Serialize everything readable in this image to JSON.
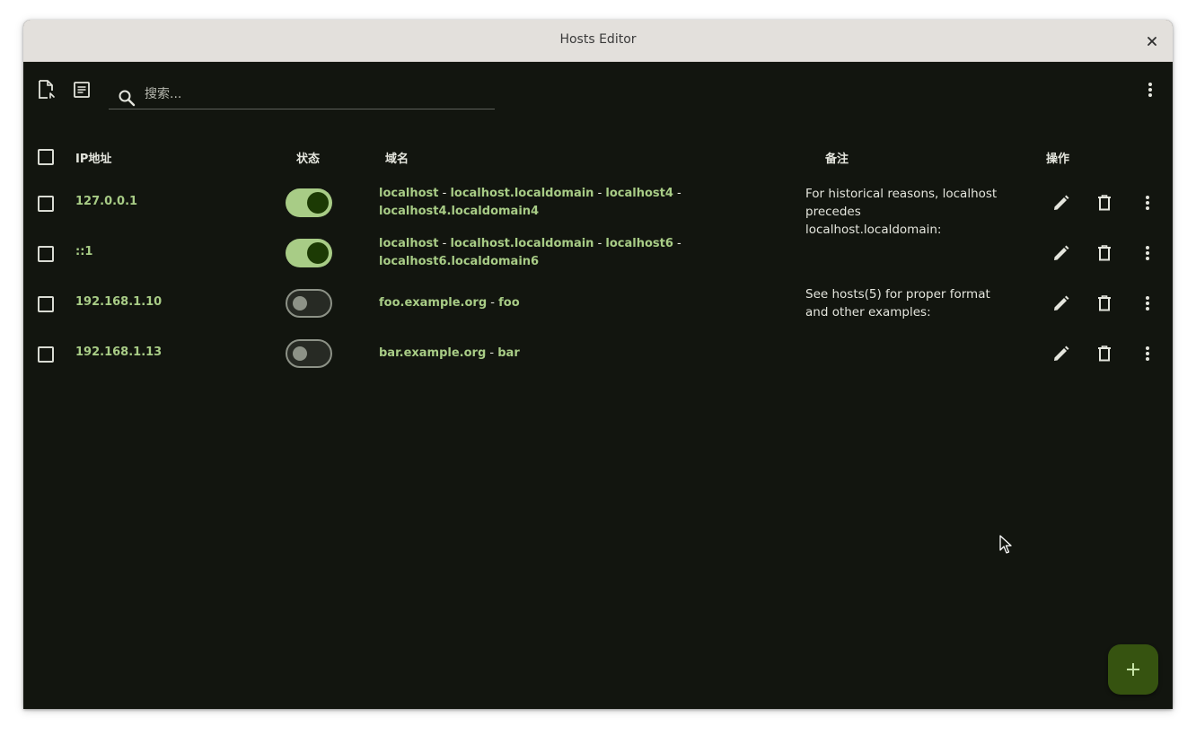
{
  "window": {
    "title": "Hosts Editor"
  },
  "toolbar": {
    "search_placeholder": "搜索..."
  },
  "table": {
    "headers": {
      "ip": "IP地址",
      "status": "状态",
      "domain": "域名",
      "comment": "备注",
      "actions": "操作"
    },
    "rows": [
      {
        "ip": "127.0.0.1",
        "enabled": true,
        "domains": [
          "localhost",
          "localhost.localdomain",
          "localhost4",
          "localhost4.localdomain4"
        ],
        "comment": "For historical reasons, localhost precedes localhost.localdomain:"
      },
      {
        "ip": "::1",
        "enabled": true,
        "domains": [
          "localhost",
          "localhost.localdomain",
          "localhost6",
          "localhost6.localdomain6"
        ],
        "comment": ""
      },
      {
        "ip": "192.168.1.10",
        "enabled": false,
        "domains": [
          "foo.example.org",
          "foo"
        ],
        "comment": "See hosts(5) for proper format and other examples:"
      },
      {
        "ip": "192.168.1.13",
        "enabled": false,
        "domains": [
          "bar.example.org",
          "bar"
        ],
        "comment": ""
      }
    ]
  },
  "fab": {
    "icon": "plus-icon"
  },
  "colors": {
    "background": "#12150f",
    "accent": "#a8cc86",
    "accent_dark": "#1c3a04",
    "fab": "#365310",
    "text": "#e4e5dd"
  }
}
